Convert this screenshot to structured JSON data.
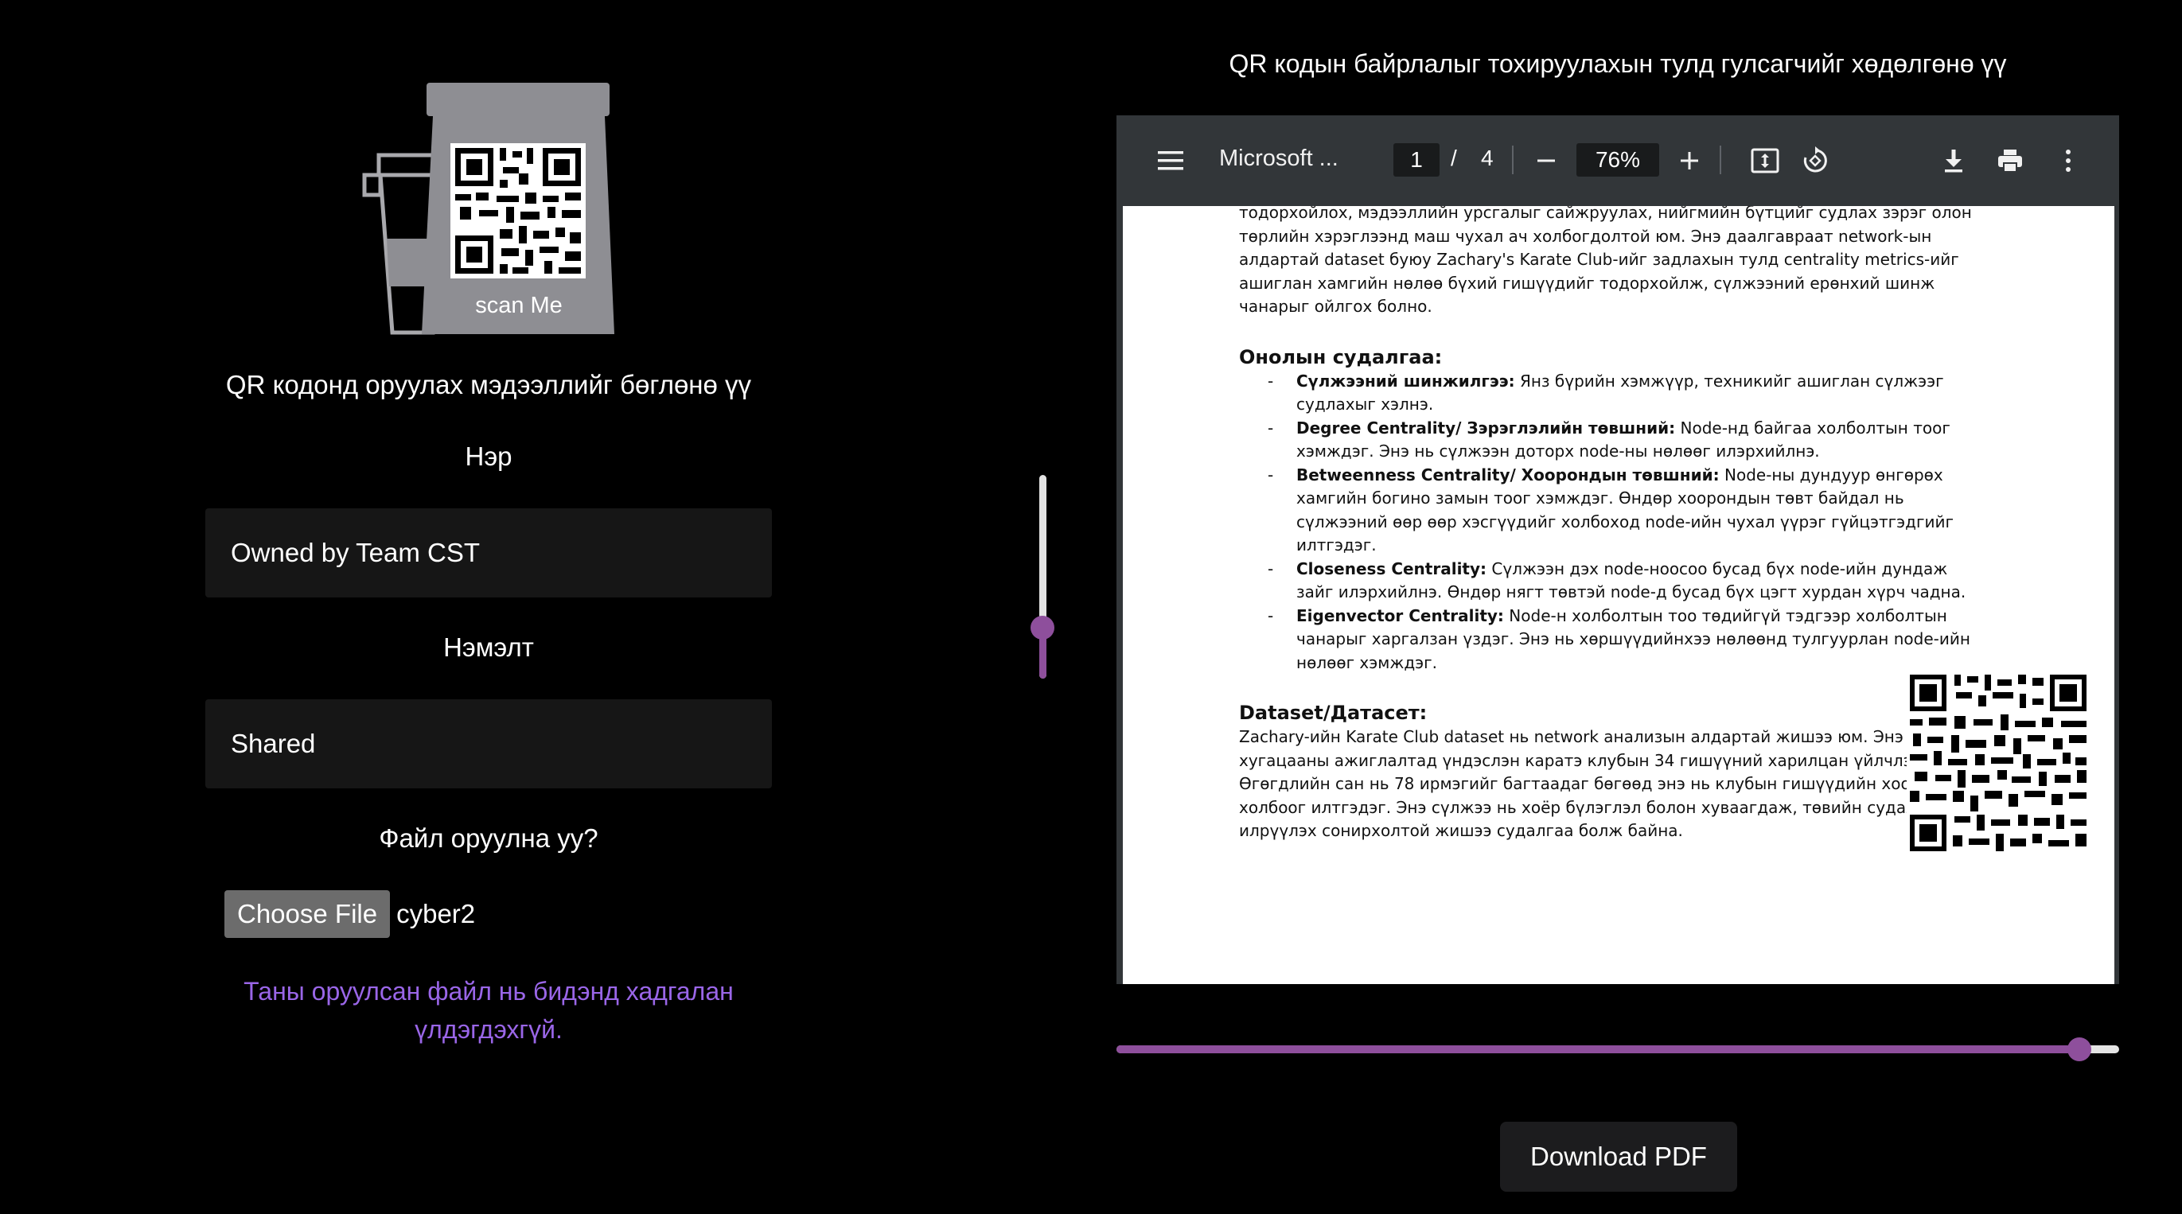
{
  "left": {
    "logo_caption": "scan Me",
    "prompt": "QR кодонд оруулах мэдээллийг бөглөнө үү",
    "name_label": "Нэр",
    "name_value": "Owned by Team CST",
    "extra_label": "Нэмэлт",
    "extra_value": "Shared",
    "file_label": "Файл оруулна уу?",
    "choose_file_label": "Choose File",
    "file_name": "cyber2",
    "notice": "Таны оруулсан файл нь бидэнд хадгалан үлдэгдэхгүй."
  },
  "vertical_slider": {
    "value_fraction": 0.25
  },
  "right": {
    "hint": "QR кодын байрлалыг тохируулахын тулд гулсагчийг хөдөлгөнө үү",
    "viewer": {
      "title": "Microsoft ...",
      "page_current": "1",
      "page_sep": "/",
      "page_total": "4",
      "zoom": "76%",
      "icons": [
        "menu-icon",
        "zoom-out-icon",
        "zoom-in-icon",
        "fit-page-icon",
        "rotate-icon",
        "download-icon",
        "print-icon",
        "more-icon"
      ]
    },
    "document": {
      "intro": "тодорхойлох, мэдээллийн урсгалыг сайжруулах, нийгмийн бүтцийг судлах зэрэг олон төрлийн хэрэглээнд маш чухал ач холбогдолтой юм. Энэ даалгавраат network-ын алдартай dataset буюу Zachary's Karate Club-ийг задлахын тулд centrality metrics-ийг ашиглан хамгийн нөлөө бүхий гишүүдийг тодорхойлж, сүлжээний ерөнхий шинж чанарыг ойлгох болно.",
      "heading1": "Онолын судалгаа:",
      "items": [
        {
          "term": "Сүлжээний шинжилгээ:",
          "text": " Янз бүрийн хэмжүүр, техникийг ашиглан сүлжээг судлахыг хэлнэ."
        },
        {
          "term": "Degree Centrality/ Зэрэглэлийн төвшний:",
          "text": " Node-нд байгаа холболтын тоог хэмждэг. Энэ нь сүлжээн доторх node-ны нөлөөг илэрхийлнэ."
        },
        {
          "term": "Betweenness Centrality/ Хоорондын төвшний:",
          "text": " Node-ны дундуур өнгөрөх хамгийн богино замын тоог хэмждэг. Өндөр хоорондын төвт байдал нь сүлжээний өөр өөр хэсгүүдийг холбоход node-ийн чухал үүрэг гүйцэтгэдгийг илтгэдэг."
        },
        {
          "term": "Closeness Centrality:",
          "text": " Сүлжээн дэх node-ноосоо бусад бүх node-ийн дундаж зайг илэрхийлнэ. Өндөр нягт төвтэй node-д бусад бүх цэгт хурдан хүрч чадна."
        },
        {
          "term": "Eigenvector Centrality:",
          "text": " Node-н холболтын тоо төдийгүй тэдгээр холболтын чанарыг харгалзан үздэг. Энэ нь хөршүүдийнхээ нөлөөнд тулгуурлан node-ийн нөлөөг хэмждэг."
        }
      ],
      "heading2": "Dataset/Датасет:",
      "dataset_text": "Zachary-ийн Karate Club dataset нь network анализын алдартай жишээ юм. Энэ нь хугацааны ажиглалтад үндэслэн каратэ клубын 34 гишүүний харилцан үйлчлэлийг Өгөгдлийн сан нь 78 ирмэгийг багтаадаг бөгөөд энэ нь клубын гишүүдийн хоорондын холбоог илтгэдэг. Энэ сүлжээ нь хоёр бүлэглэл болон хуваагдаж, төвийн судалгааг илрүүлэх сонирхолтой жишээ судалгаа болж байна."
    },
    "horizontal_slider": {
      "value_fraction": 0.96
    },
    "download_label": "Download PDF"
  },
  "colors": {
    "accent": "#8e4f9c",
    "notice": "#9a66e8",
    "viewer_toolbar": "#323639"
  }
}
